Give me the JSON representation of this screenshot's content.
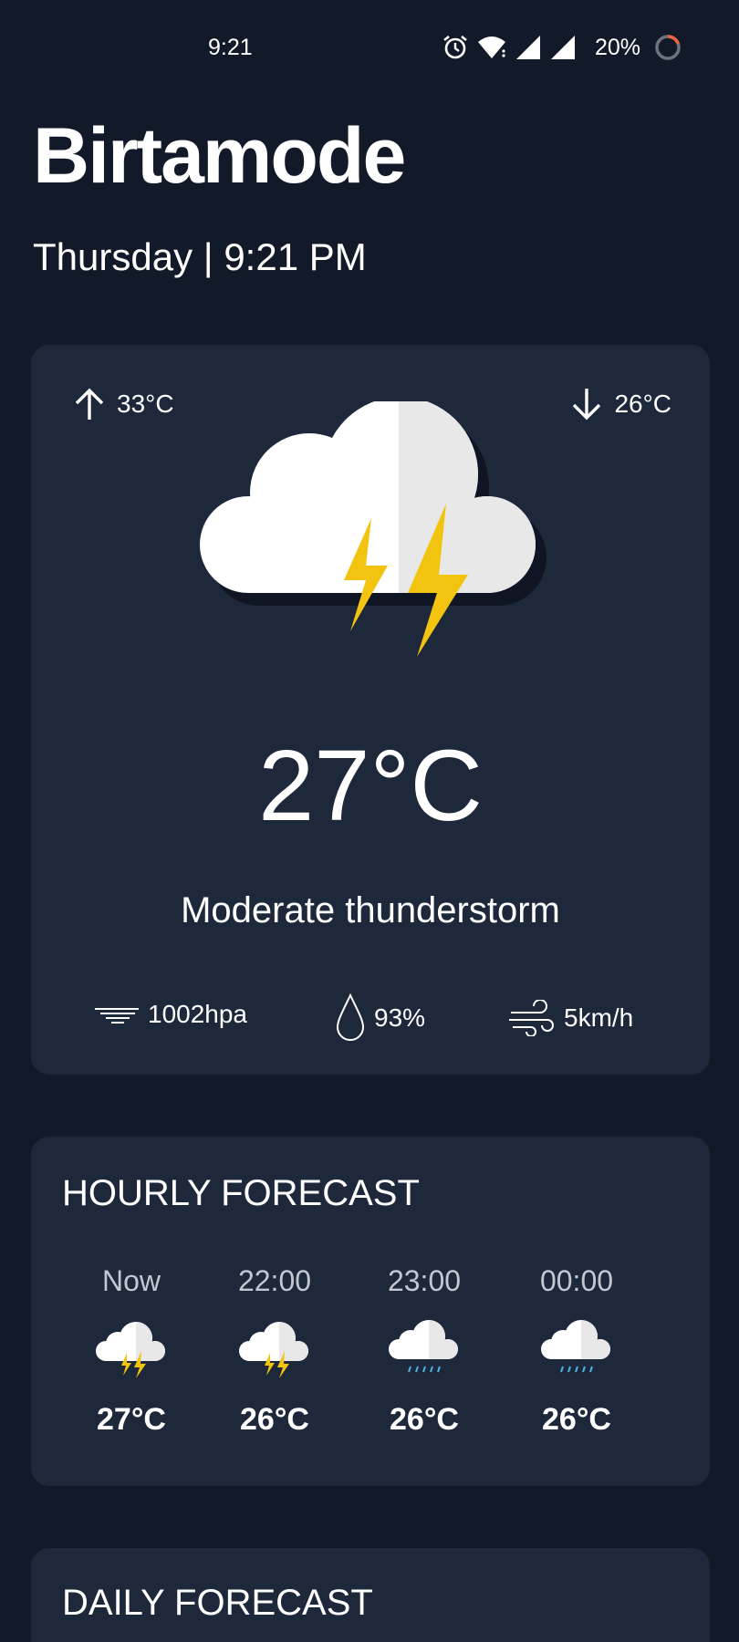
{
  "status_bar": {
    "time": "9:21",
    "battery": "20%",
    "icons": [
      "alarm-icon",
      "wifi-icon",
      "signal-icon",
      "signal-icon",
      "battery-ring-icon"
    ]
  },
  "header": {
    "location": "Birtamode",
    "date_time": "Thursday | 9:21 PM"
  },
  "current": {
    "high": "33°C",
    "low": "26°C",
    "icon": "thunderstorm-icon",
    "temperature": "27°C",
    "condition": "Moderate thunderstorm",
    "pressure": "1002hpa",
    "humidity": "93%",
    "wind": "5km/h"
  },
  "hourly": {
    "title": "HOURLY FORECAST",
    "items": [
      {
        "time": "Now",
        "icon": "thunderstorm-icon",
        "temp": "27°C"
      },
      {
        "time": "22:00",
        "icon": "thunderstorm-icon",
        "temp": "26°C"
      },
      {
        "time": "23:00",
        "icon": "rain-icon",
        "temp": "26°C"
      },
      {
        "time": "00:00",
        "icon": "rain-icon",
        "temp": "26°C"
      }
    ]
  },
  "daily": {
    "title": "DAILY FORECAST"
  },
  "colors": {
    "background": "#121a29",
    "card": "#1e283b",
    "bolt": "#f2c40f",
    "rain": "#4fb3e8",
    "battery_accent": "#e8643c"
  }
}
